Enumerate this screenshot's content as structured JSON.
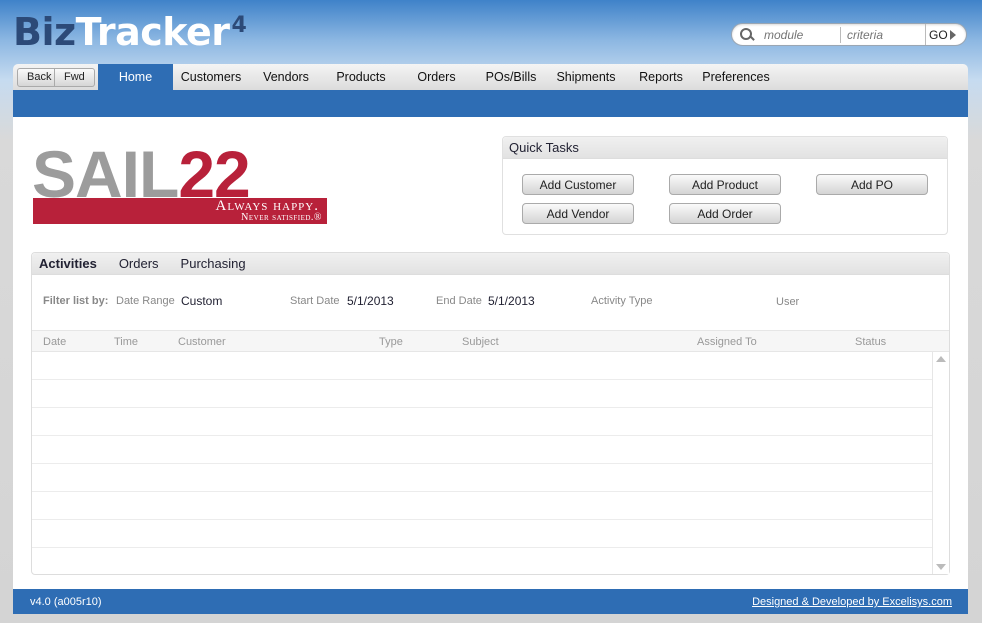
{
  "brand": {
    "biz": "Biz",
    "tracker": "Tracker",
    "version_mark": "4"
  },
  "search": {
    "module_placeholder": "module",
    "criteria_placeholder": "criteria",
    "go_label": "GO"
  },
  "nav": {
    "back": "Back",
    "fwd": "Fwd",
    "tabs": [
      "Home",
      "Customers",
      "Vendors",
      "Products",
      "Orders",
      "POs/Bills",
      "Shipments",
      "Reports",
      "Preferences"
    ],
    "active": "Home"
  },
  "logo": {
    "sail": "SAIL",
    "num": "22",
    "tagline1": "Always happy.",
    "tagline2": "Never satisfied.®"
  },
  "quick_tasks": {
    "title": "Quick Tasks",
    "buttons": [
      "Add Customer",
      "Add Product",
      "Add PO",
      "Add Vendor",
      "Add Order"
    ]
  },
  "activities": {
    "tabs": [
      "Activities",
      "Orders",
      "Purchasing"
    ],
    "filter": {
      "label": "Filter list by:",
      "date_range_label": "Date Range",
      "date_range_value": "Custom",
      "start_date_label": "Start Date",
      "start_date_value": "5/1/2013",
      "end_date_label": "End Date",
      "end_date_value": "5/1/2013",
      "activity_type_label": "Activity Type",
      "user_label": "User"
    },
    "columns": [
      "Date",
      "Time",
      "Customer",
      "Type",
      "Subject",
      "Assigned To",
      "Status"
    ]
  },
  "footer": {
    "version": "v4.0 (a005r10)",
    "credit": "Designed & Developed by Excelisys.com"
  },
  "colors": {
    "nav_blue": "#2e6db4",
    "logo_red": "#b8213a",
    "logo_gray": "#9c9c9c"
  }
}
